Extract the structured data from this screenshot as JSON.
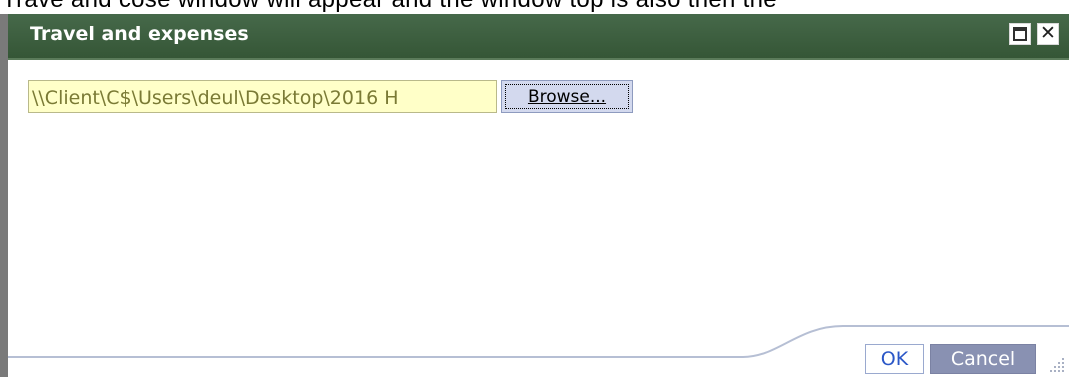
{
  "background_text": "Trave and cose window will appear and the window top is also then the",
  "window": {
    "title": "Travel and expenses",
    "maximize_icon": "maximize-icon",
    "close_icon": "close-icon",
    "close_glyph": "✕"
  },
  "file_upload": {
    "path_value": "\\\\Client\\C$\\Users\\deul\\Desktop\\2016 H",
    "browse_label": "Browse..."
  },
  "footer": {
    "ok_label": "OK",
    "cancel_label": "Cancel"
  },
  "colors": {
    "titlebar": "#3d5f3a",
    "path_field_bg": "#ffffc8",
    "browse_bg": "#d3d9ee",
    "ok_text": "#2b57c7",
    "cancel_bg": "#8991b2"
  }
}
